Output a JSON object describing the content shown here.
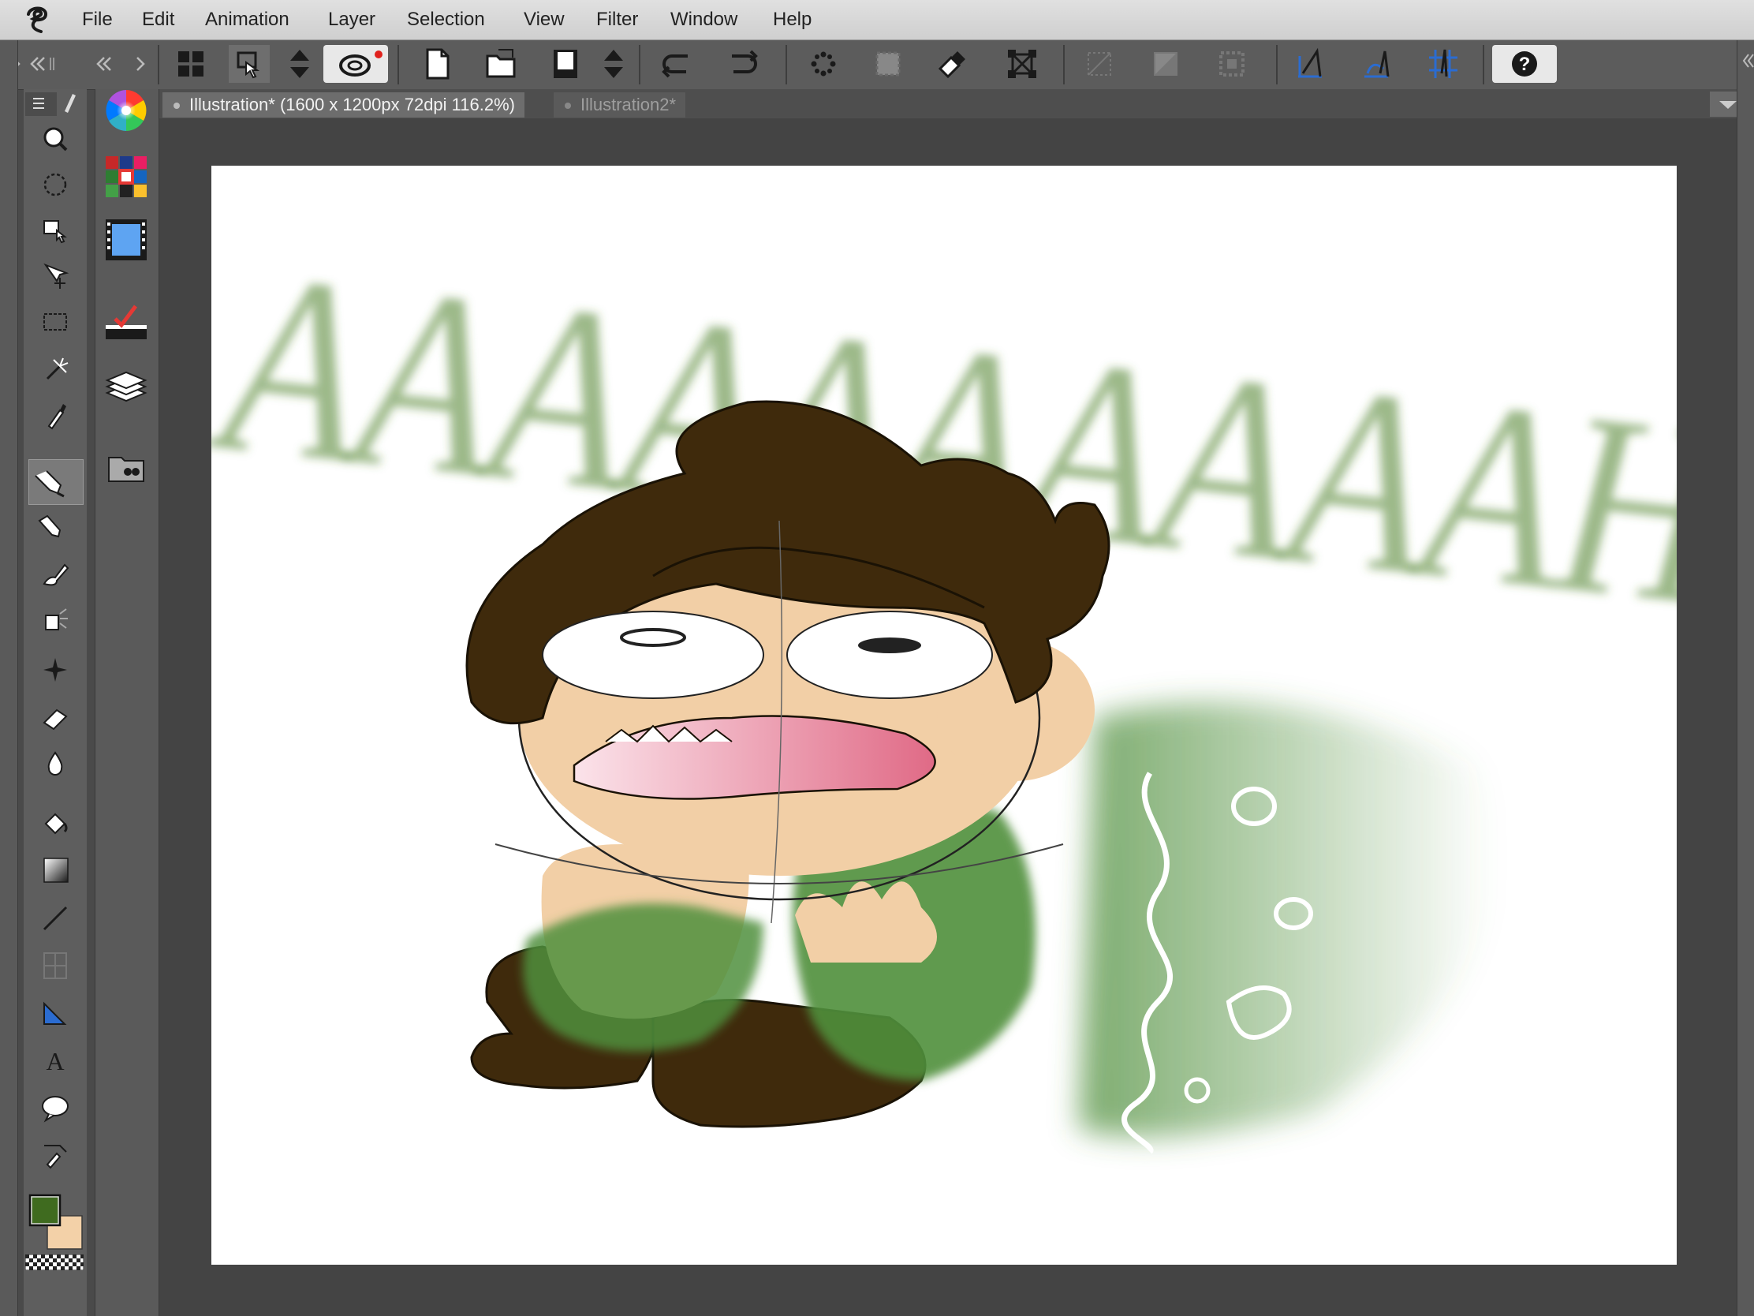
{
  "menubar": {
    "items": [
      "File",
      "Edit",
      "Animation",
      "Layer",
      "Selection",
      "View",
      "Filter",
      "Window",
      "Help"
    ]
  },
  "toolbar": {
    "icons": [
      "grid-icon",
      "change-window-icon",
      "stepper-icon",
      "stabilizer-icon",
      "new-file-icon",
      "open-icon",
      "save-icon",
      "stepper-icon",
      "undo-icon",
      "redo-icon",
      "clear-icon",
      "fill-icon",
      "clear-selection-icon",
      "transform-icon",
      "deselect-icon",
      "invert-selection-icon",
      "selection-launcher-icon",
      "ruler-snap-icon",
      "special-ruler-icon",
      "grid-snap-icon",
      "help-icon"
    ]
  },
  "tabs": [
    {
      "label": "Illustration* (1600 x 1200px 72dpi 116.2%)",
      "active": true
    },
    {
      "label": "Illustration2*",
      "active": false
    }
  ],
  "tools": [
    "zoom-icon",
    "rotate-icon",
    "hand-icon",
    "move-icon",
    "rect-select-icon",
    "magic-wand-icon",
    "eyedropper-icon",
    "pen-icon",
    "pencil-icon",
    "brush-icon",
    "airbrush-icon",
    "decoration-icon",
    "eraser-icon",
    "blend-icon",
    "fill-bucket-icon",
    "gradient-icon",
    "line-icon",
    "frame-icon",
    "ruler-icon",
    "text-icon",
    "balloon-icon",
    "correct-line-icon"
  ],
  "subpanels": [
    "color-wheel-icon",
    "color-set-icon",
    "timeline-icon",
    "layer-property-icon",
    "layers-icon",
    "materials-icon"
  ],
  "colors": {
    "main": "#3f6b1f",
    "sub": "#f3d1a8",
    "accent_line": "#2b6cd1"
  },
  "canvas": {
    "shout_text": "AAAAAAAAAAH"
  }
}
